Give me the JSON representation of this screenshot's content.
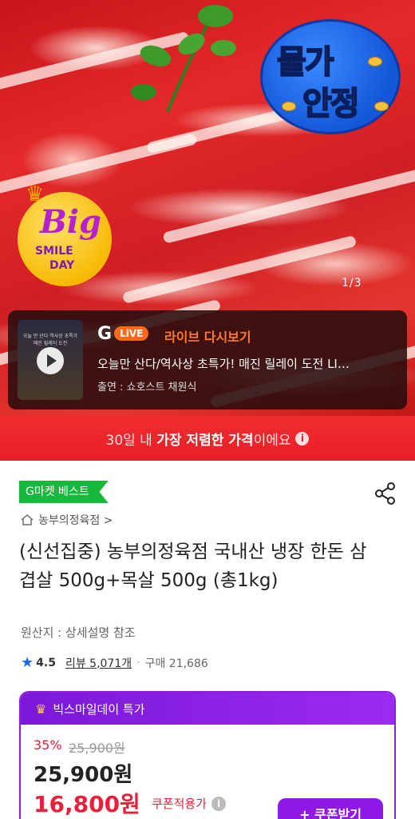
{
  "hero": {
    "badge_stable_line1": "물가",
    "badge_stable_line2": "안정",
    "badge_big": "Big",
    "badge_smile": "SMILE",
    "badge_day": "DAY",
    "pager": "1/3"
  },
  "live": {
    "logo_g": "G",
    "logo_live": "LiVE",
    "title": "라이브 다시보기",
    "description": "오늘만 산다/역사상 초특가! 매진 릴레이 도전 LI…",
    "host": "출연 : 쇼호스트 채원식",
    "thumb_text": "오늘 만 산다\n역사상 초특가\n매진 릴레이 도전"
  },
  "banner": {
    "prefix": "30일 내 ",
    "highlight": "가장 저렴한 가격",
    "suffix": "이에요",
    "info": "i"
  },
  "product": {
    "best_badge": "G마켓 베스트",
    "breadcrumb": "농부의정육점 >",
    "title": "(신선집중) 농부의정육점 국내산 냉장 한돈 삼겹살 500g+목살 500g (총1kg)",
    "origin": "원산지 : 상세설명 참조",
    "rating": "4.5",
    "review": "리뷰 5,071개",
    "separator": "·",
    "purchases": "구매 21,686"
  },
  "deal": {
    "header": "빅스마일데이 특가",
    "discount_pct": "35%",
    "original_price": "25,900원",
    "price": "25,900원",
    "coupon_price": "16,800원",
    "coupon_label": "쿠폰적용가",
    "coupon_info": "i",
    "button": "+ 쿠폰받기"
  },
  "colors": {
    "accent_red": "#e81f2a",
    "purple": "#8f1ae6",
    "green_badge": "#18b83c",
    "live_orange": "#ff7a2e"
  }
}
